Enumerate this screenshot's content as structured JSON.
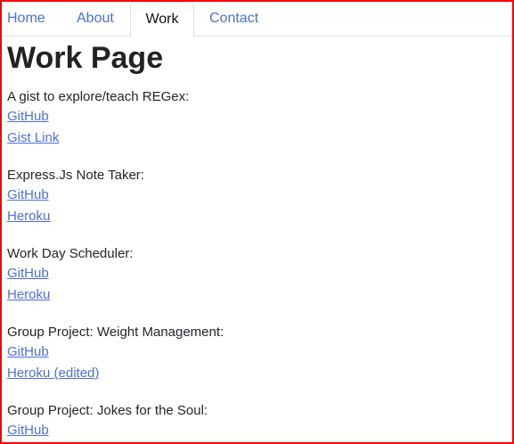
{
  "nav": {
    "tabs": [
      {
        "label": "Home",
        "active": false
      },
      {
        "label": "About",
        "active": false
      },
      {
        "label": "Work",
        "active": true
      },
      {
        "label": "Contact",
        "active": false
      }
    ]
  },
  "page": {
    "title": "Work Page"
  },
  "projects": [
    {
      "description": "A gist to explore/teach REGex:",
      "links": [
        "GitHub",
        "Gist Link"
      ]
    },
    {
      "description": "Express.Js Note Taker:",
      "links": [
        "GitHub",
        "Heroku"
      ]
    },
    {
      "description": "Work Day Scheduler:",
      "links": [
        "GitHub",
        "Heroku"
      ]
    },
    {
      "description": "Group Project: Weight Management:",
      "links": [
        "GitHub",
        "Heroku (edited)"
      ]
    },
    {
      "description": "Group Project: Jokes for the Soul:",
      "links": [
        "GitHub"
      ]
    }
  ],
  "colors": {
    "link": "#4a6fe3",
    "frame_border": "#ff0000",
    "text": "#212529"
  }
}
